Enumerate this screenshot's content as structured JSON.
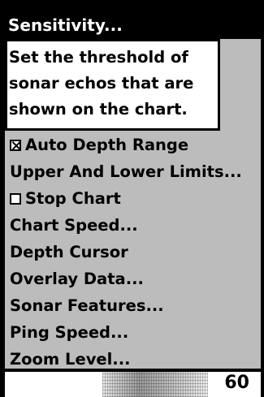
{
  "menu": {
    "title": "Sensitivity...",
    "tooltip_lines": [
      "Set the threshold of",
      "sonar echos that are",
      "shown on the chart."
    ],
    "items": [
      {
        "label": "Auto Depth Range",
        "checkbox": true,
        "checked": true
      },
      {
        "label": "Upper And Lower Limits...",
        "checkbox": false
      },
      {
        "label": "Stop Chart",
        "checkbox": true,
        "checked": false
      },
      {
        "label": "Chart Speed...",
        "checkbox": false
      },
      {
        "label": "Depth Cursor",
        "checkbox": false
      },
      {
        "label": "Overlay Data...",
        "checkbox": false
      },
      {
        "label": "Sonar Features...",
        "checkbox": false
      },
      {
        "label": "Ping Speed...",
        "checkbox": false
      },
      {
        "label": "Zoom Level...",
        "checkbox": false
      }
    ]
  },
  "sonar": {
    "depth_label": "60"
  },
  "colors": {
    "menu_background": "#bcbcbc",
    "highlight_background": "#000000",
    "highlight_text": "#ffffff",
    "tooltip_background": "#ffffff"
  }
}
